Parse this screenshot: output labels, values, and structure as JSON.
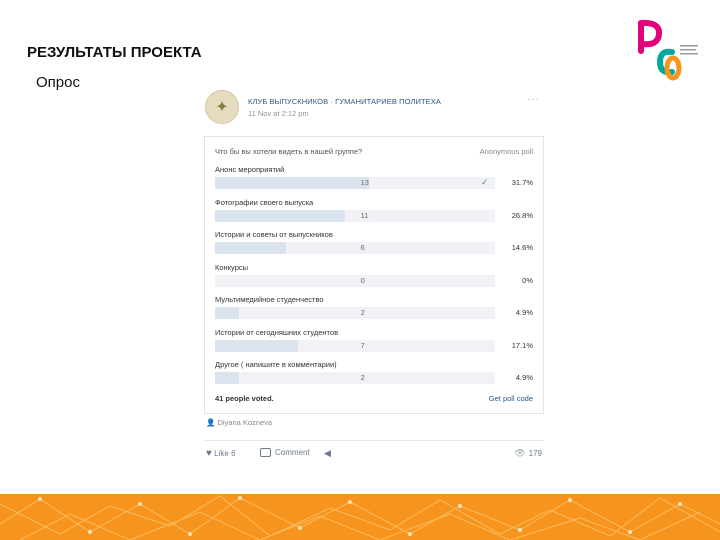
{
  "slide": {
    "title": "РЕЗУЛЬТАТЫ ПРОЕКТА",
    "subtitle": "Опрос"
  },
  "logo": {
    "letters": "РСО"
  },
  "post": {
    "group_name": "КЛУБ ВЫПУСКНИКОВ · ГУМАНИТАРИЕВ ПОЛИТЕХА",
    "date": "11 Nov at 2:12 pm",
    "more": "···",
    "poll": {
      "question": "Что бы вы хотели видеть в нашей группе?",
      "type": "Anonymous poll",
      "options": [
        {
          "label": "Анонс мероприятий",
          "count": "13",
          "percent": "31.7%",
          "share": 0.317,
          "checked": true
        },
        {
          "label": "Фотографии своего выпуска",
          "count": "11",
          "percent": "26.8%",
          "share": 0.268,
          "checked": false
        },
        {
          "label": "Истории и советы от выпускников",
          "count": "6",
          "percent": "14.6%",
          "share": 0.146,
          "checked": false
        },
        {
          "label": "Конкурсы",
          "count": "0",
          "percent": "0%",
          "share": 0.0,
          "checked": false
        },
        {
          "label": "Мультимедийное студенчество",
          "count": "2",
          "percent": "4.9%",
          "share": 0.049,
          "checked": false
        },
        {
          "label": "Истории от сегодняшних студентов",
          "count": "7",
          "percent": "17.1%",
          "share": 0.171,
          "checked": false
        },
        {
          "label": "Другое ( напишите в комментарии)",
          "count": "2",
          "percent": "4.9%",
          "share": 0.049,
          "checked": false
        }
      ],
      "voted": "41 people voted.",
      "get_code": "Get poll code"
    },
    "author": "Diyana Kozneva",
    "actions": {
      "like_label": "Like",
      "like_count": "6",
      "comment_label": "Comment",
      "views": "179"
    }
  },
  "colors": {
    "band_orange": "#f7941d",
    "band_light": "#fbb040",
    "vk_blue": "#2a5885",
    "bar_fill": "#dbe4ee"
  }
}
